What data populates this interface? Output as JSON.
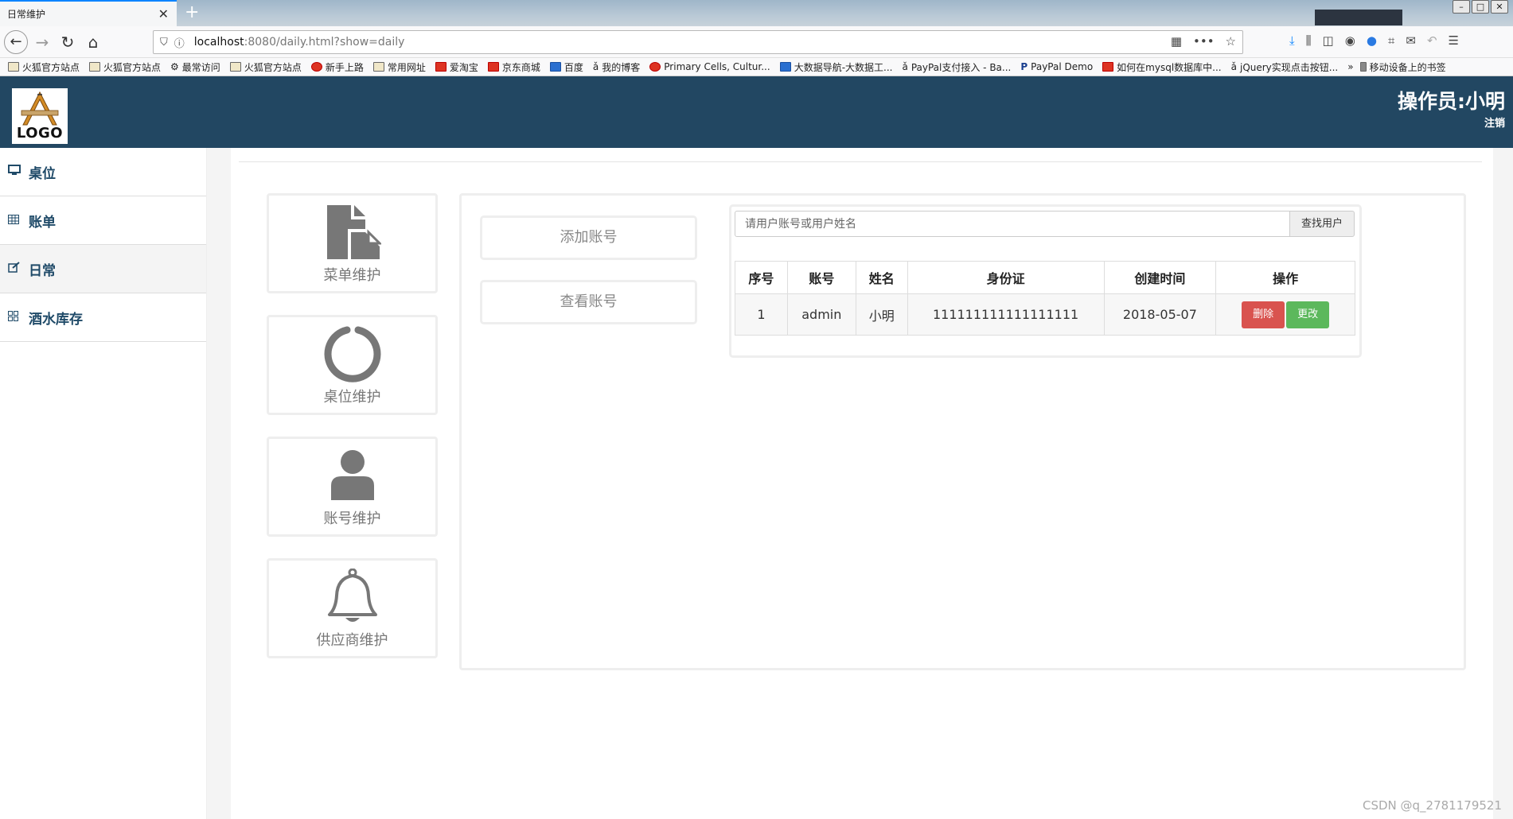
{
  "browser": {
    "tab_title": "日常维护",
    "url_host": "localhost",
    "url_rest": ":8080/daily.html?show=daily",
    "bookmarks": [
      "火狐官方站点",
      "火狐官方站点",
      "最常访问",
      "火狐官方站点",
      "新手上路",
      "常用网址",
      "爱淘宝",
      "京东商城",
      "百度",
      "我的博客",
      "Primary Cells, Cultur...",
      "大数据导航-大数据工...",
      "PayPal支付接入 - Ba...",
      "PayPal Demo",
      "如何在mysql数据库中...",
      "jQuery实现点击按钮...",
      "移动设备上的书签"
    ]
  },
  "header": {
    "logo_text": "LOGO",
    "operator": "操作员:小明",
    "logout": "注销"
  },
  "sidebar": {
    "items": [
      {
        "label": "桌位",
        "icon": "monitor-icon"
      },
      {
        "label": "账单",
        "icon": "table-icon"
      },
      {
        "label": "日常",
        "icon": "edit-icon"
      },
      {
        "label": "酒水库存",
        "icon": "grid-icon"
      }
    ],
    "active": "日常"
  },
  "tiles": [
    {
      "label": "菜单维护",
      "icon": "file-icon"
    },
    {
      "label": "桌位维护",
      "icon": "circle-icon"
    },
    {
      "label": "账号维护",
      "icon": "user-icon"
    },
    {
      "label": "供应商维护",
      "icon": "bell-icon"
    }
  ],
  "actions": {
    "add_account": "添加账号",
    "view_account": "查看账号"
  },
  "search": {
    "placeholder": "请用户账号或用户姓名",
    "button": "查找用户"
  },
  "table": {
    "headers": [
      "序号",
      "账号",
      "姓名",
      "身份证",
      "创建时间",
      "操作"
    ],
    "rows": [
      {
        "no": "1",
        "account": "admin",
        "name": "小明",
        "id_card": "111111111111111111",
        "created": "2018-05-07",
        "delete": "删除",
        "edit": "更改"
      }
    ]
  },
  "watermark": "CSDN @q_2781179521"
}
